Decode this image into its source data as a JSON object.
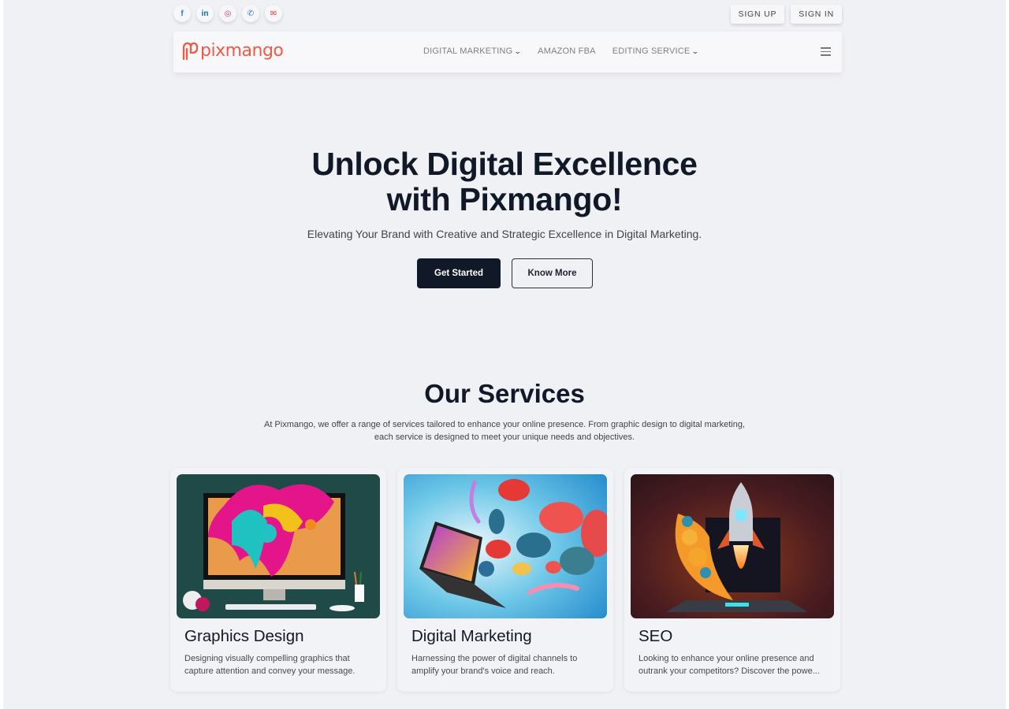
{
  "topbar": {
    "socials": [
      {
        "name": "facebook",
        "glyph": "f",
        "color": "#1877f2"
      },
      {
        "name": "linkedin",
        "glyph": "in",
        "color": "#0a66c2"
      },
      {
        "name": "instagram",
        "glyph": "◎",
        "color": "#c13584"
      },
      {
        "name": "phone",
        "glyph": "✆",
        "color": "#1877f2"
      },
      {
        "name": "email",
        "glyph": "✉",
        "color": "#e53935"
      }
    ],
    "sign_up": "SIGN UP",
    "sign_in": "SIGN IN"
  },
  "navbar": {
    "logo_text": "pixmango",
    "brand_color": "#f05a44",
    "links": [
      {
        "label": "DIGITAL MARKETING",
        "has_dropdown": true
      },
      {
        "label": "AMAZON FBA",
        "has_dropdown": false
      },
      {
        "label": "EDITING SERVICE",
        "has_dropdown": true
      }
    ],
    "chevron": "⌄"
  },
  "hero": {
    "title_line1": "Unlock Digital Excellence",
    "title_line2": "with Pixmango!",
    "subtitle": "Elevating Your Brand with Creative and Strategic Excellence in Digital Marketing.",
    "primary_cta": "Get Started",
    "secondary_cta": "Know More"
  },
  "services": {
    "title": "Our Services",
    "description_line1": "At Pixmango, we offer a range of services tailored to enhance your online presence. From graphic design to digital marketing,",
    "description_line2": "each service is designed to meet your unique needs and objectives.",
    "cards": [
      {
        "title": "Graphics Design",
        "description": "Designing visually compelling graphics that capture attention and convey your message.",
        "image": "paint-splash-monitor-illustration"
      },
      {
        "title": "Digital Marketing",
        "description": "Harnessing the power of digital channels to amplify your brand's voice and reach.",
        "image": "laptop-social-reactions-illustration"
      },
      {
        "title": "SEO",
        "description": "Looking to enhance your online presence and outrank your competitors? Discover the powe...",
        "image": "rocket-laptop-launch-illustration"
      }
    ]
  }
}
